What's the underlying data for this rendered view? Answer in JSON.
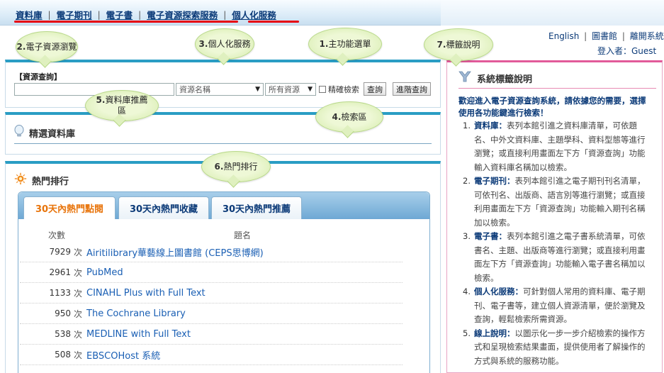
{
  "nav": {
    "items": [
      "資料庫",
      "電子期刊",
      "電子書",
      "電子資源探索服務",
      "個人化服務"
    ],
    "separator": "|"
  },
  "header": {
    "links": [
      "English",
      "圖書館",
      "離開系統"
    ],
    "link_separator": "|",
    "login_label": "登入者：Guest"
  },
  "callouts": {
    "c1": {
      "num": "1.",
      "text": "主功能選單"
    },
    "c2": {
      "num": "2.",
      "text": "電子資源瀏覽"
    },
    "c3": {
      "num": "3.",
      "text": "個人化服務"
    },
    "c4": {
      "num": "4.",
      "text": "檢索區"
    },
    "c5": {
      "num": "5.",
      "text": "資料庫推薦區"
    },
    "c6": {
      "num": "6.",
      "text": "熱門排行"
    },
    "c7": {
      "num": "7.",
      "text": "標籤說明"
    }
  },
  "search": {
    "label": "【資源查詢】",
    "input_value": "",
    "field_select": "資源名稱",
    "scope_select": "所有資源",
    "exact_label": "精確檢索",
    "exact_checked": false,
    "search_button": "查詢",
    "advanced_button": "進階查詢"
  },
  "featured": {
    "title": "精選資料庫",
    "icon": "lightbulb-icon"
  },
  "hot": {
    "title": "熱門排行",
    "icon": "sun-icon",
    "tabs": [
      "30天內熱門點閱",
      "30天內熱門收藏",
      "30天內熱門推薦"
    ],
    "active_tab": 0,
    "columns": {
      "count": "次數",
      "title": "題名"
    },
    "unit": "次",
    "rows": [
      {
        "count": "7929",
        "title": "Airitilibrary華藝線上圖書館 (CEPS思博網)"
      },
      {
        "count": "2961",
        "title": "PubMed"
      },
      {
        "count": "1133",
        "title": "CINAHL Plus with Full Text"
      },
      {
        "count": "950",
        "title": "The Cochrane Library"
      },
      {
        "count": "538",
        "title": "MEDLINE with Full Text"
      },
      {
        "count": "508",
        "title": "EBSCOHost 系統"
      }
    ]
  },
  "help": {
    "title": "系統標籤說明",
    "intro": "歡迎進入電子資源查詢系統，請依據您的需要，選擇使用各功能鍵進行檢索！",
    "items": [
      {
        "num": "1.",
        "term": "資料庫：",
        "desc": "表列本館引進之資料庫清單，可依題名、中外文資料庫、主題學科、資料型態等進行瀏覽；或直接利用畫面左下方「資源查詢」功能輸入資料庫名稱加以檢索。"
      },
      {
        "num": "2.",
        "term": "電子期刊：",
        "desc": "表列本館引進之電子期刊刊名清單，可依刊名、出版商、語言別等進行瀏覽；或直接利用畫面左下方「資源查詢」功能輸入期刊名稱加以檢索。"
      },
      {
        "num": "3.",
        "term": "電子書：",
        "desc": "表列本館引進之電子書系統清單，可依書名、主題、出版商等進行瀏覽；或直接利用畫面左下方「資源查詢」功能輸入電子書名稱加以檢索。"
      },
      {
        "num": "4.",
        "term": "個人化服務：",
        "desc": "可針對個人常用的資料庫、電子期刊、電子書等，建立個人資源清單，便於瀏覽及查詢，輕鬆檢索所需資源。"
      },
      {
        "num": "5.",
        "term": "線上說明：",
        "desc": "以圖示化一步一步介紹檢索的操作方式和呈現檢索結果畫面，提供使用者了解操作的方式與系統的服務功能。"
      }
    ]
  },
  "colors": {
    "accent_blue": "#2a9dc4",
    "nav_text": "#0b3a78",
    "underline_red": "#e60012",
    "help_border": "#e25a9a",
    "active_tab": "#e8740b",
    "callout_green": "#d4ebaa"
  }
}
